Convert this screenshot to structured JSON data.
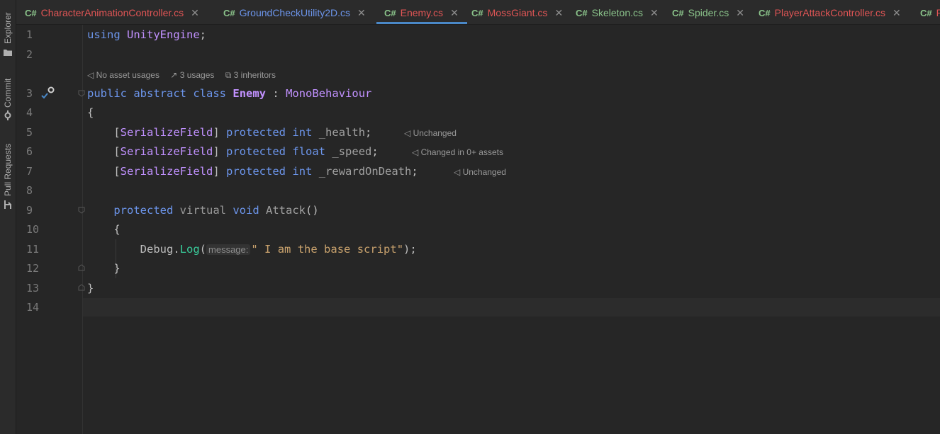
{
  "sidebar": {
    "items": [
      {
        "label": "Explorer",
        "icon": "folder-icon"
      },
      {
        "label": "Commit",
        "icon": "commit-icon"
      },
      {
        "label": "Pull Requests",
        "icon": "pull-request-icon"
      }
    ]
  },
  "tabs": [
    {
      "lang": "C#",
      "label": "CharacterAnimationController.cs",
      "color": "#e05555",
      "active": false
    },
    {
      "lang": "C#",
      "label": "GroundCheckUtility2D.cs",
      "color": "#6c95eb",
      "active": false
    },
    {
      "lang": "C#",
      "label": "Enemy.cs",
      "color": "#e05555",
      "active": true
    },
    {
      "lang": "C#",
      "label": "MossGiant.cs",
      "color": "#e05555",
      "active": false
    },
    {
      "lang": "C#",
      "label": "Skeleton.cs",
      "color": "#8ac28a",
      "active": false
    },
    {
      "lang": "C#",
      "label": "Spider.cs",
      "color": "#8ac28a",
      "active": false
    },
    {
      "lang": "C#",
      "label": "PlayerAttackController.cs",
      "color": "#e05555",
      "active": false
    },
    {
      "lang": "C#",
      "label": "P",
      "color": "#e05555",
      "active": false
    }
  ],
  "tab_close": "✕",
  "line_numbers": [
    "1",
    "2",
    "3",
    "4",
    "5",
    "6",
    "7",
    "8",
    "9",
    "10",
    "11",
    "12",
    "13",
    "14"
  ],
  "code_vision": {
    "asset_usages": "No asset usages",
    "usages": "3 usages",
    "inheritors": "3 inheritors"
  },
  "code": {
    "l1_kw": "using",
    "l1_ns": "UnityEngine",
    "l1_end": ";",
    "l3_kw1": "public",
    "l3_kw2": "abstract",
    "l3_kw3": "class",
    "l3_name": "Enemy",
    "l3_colon": ":",
    "l3_base": "MonoBehaviour",
    "brace_open": "{",
    "brace_close": "}",
    "attr_open": "[",
    "attr_name": "SerializeField",
    "attr_close": "]",
    "protected": "protected",
    "int": "int",
    "float": "float",
    "f1": "_health",
    "f2": "_speed",
    "f3": "_rewardOnDeath",
    "semi": ";",
    "l9_virtual": "virtual",
    "l9_void": "void",
    "l9_name": "Attack",
    "l9_parens": "()",
    "l11_debug": "Debug",
    "l11_dot": ".",
    "l11_log": "Log",
    "l11_open": "(",
    "l11_hint": "message:",
    "l11_str": "\" I am the base script\"",
    "l11_end": ");"
  },
  "annotations": {
    "l5": "Unchanged",
    "l6": "Changed in 0+ assets",
    "l7": "Unchanged"
  }
}
